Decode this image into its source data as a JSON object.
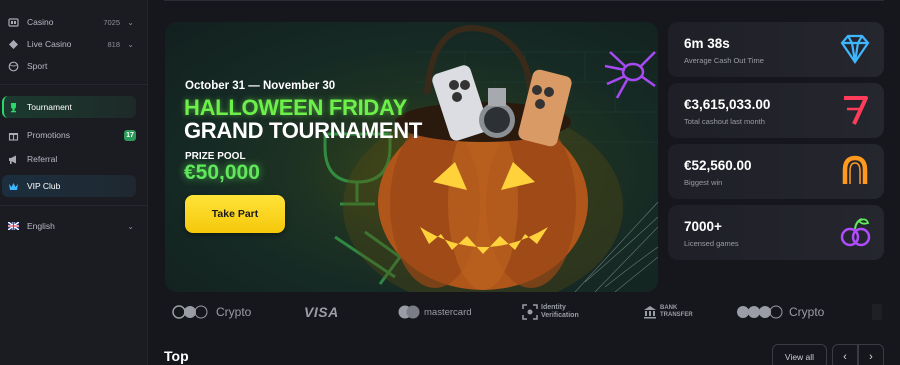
{
  "sidebar": {
    "casino": {
      "label": "Casino",
      "count": "7025"
    },
    "live_casino": {
      "label": "Live Casino",
      "count": "818"
    },
    "sport": {
      "label": "Sport"
    },
    "tournament": {
      "label": "Tournament"
    },
    "promotions": {
      "label": "Promotions",
      "badge": "17"
    },
    "referral": {
      "label": "Referral"
    },
    "vip": {
      "label": "VIP Club"
    },
    "language": {
      "label": "English"
    }
  },
  "banner": {
    "dates": "October 31 — November 30",
    "title_line1": "HALLOWEEN FRIDAY",
    "title_line2": "GRAND TOURNAMENT",
    "prize_label": "PRIZE POOL",
    "prize_amount": "€50,000",
    "cta": "Take Part"
  },
  "stats": [
    {
      "value": "6m 38s",
      "label": "Average Cash Out Time",
      "icon": "diamond-icon",
      "color": "#3fb7ff"
    },
    {
      "value": "€3,615,033.00",
      "label": "Total cashout last month",
      "icon": "seven-icon",
      "color": "#ff3d5a"
    },
    {
      "value": "€52,560.00",
      "label": "Biggest win",
      "icon": "horseshoe-icon",
      "color": "#ff9a1f"
    },
    {
      "value": "7000+",
      "label": "Licensed games",
      "icon": "plum-icon",
      "color": "#b04cff"
    }
  ],
  "payments": {
    "crypto1": "Crypto",
    "visa": "VISA",
    "mastercard": "mastercard",
    "identity": "Identity Verification",
    "bank": "BANK TRANSFER",
    "crypto2": "Crypto"
  },
  "section": {
    "title": "Top",
    "view_all": "View all"
  }
}
